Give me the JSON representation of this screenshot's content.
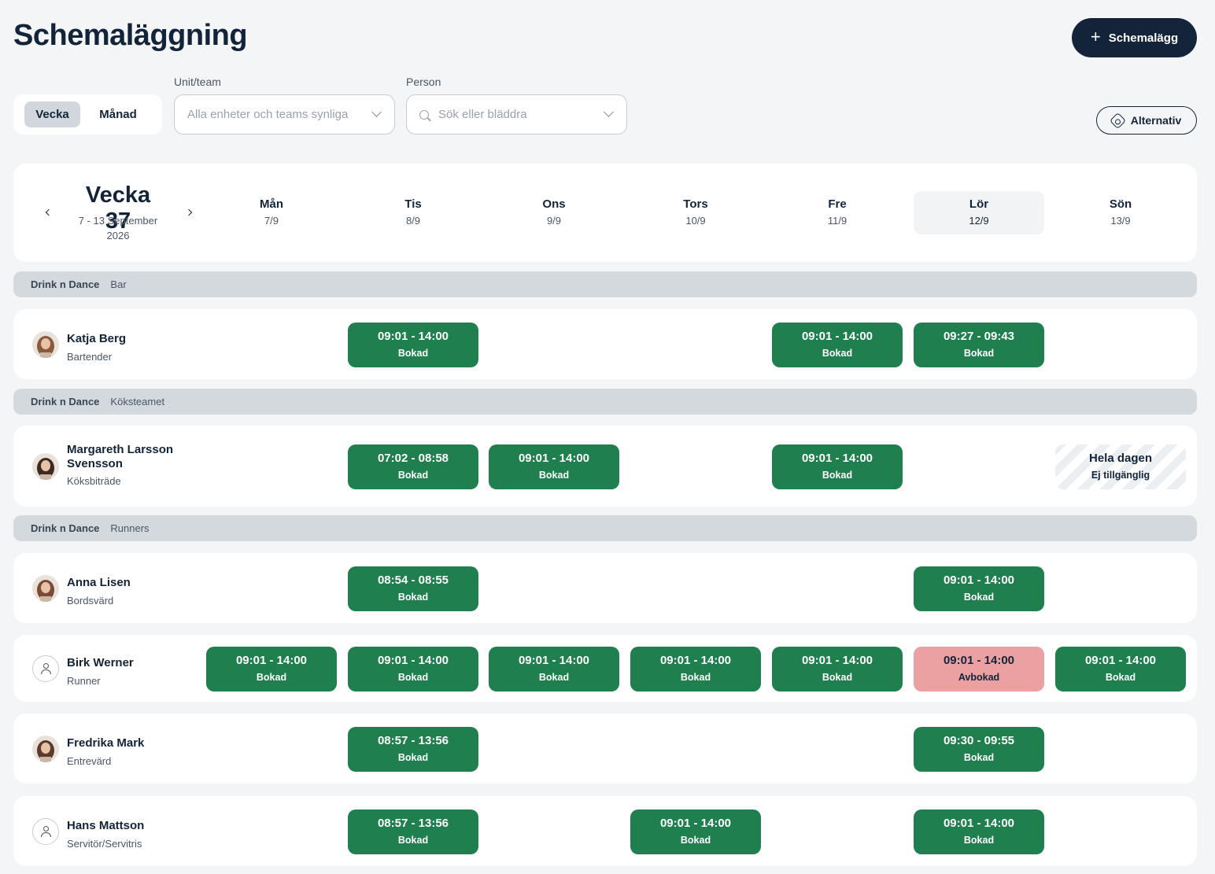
{
  "page": {
    "title": "Schemaläggning",
    "schedule_button": "Schemalägg",
    "schedule_button_icon": "plus-icon"
  },
  "view_toggle": {
    "week": "Vecka",
    "month": "Månad"
  },
  "filters": {
    "unit_label": "Unit/team",
    "unit_placeholder": "Alla enheter och teams synliga",
    "person_label": "Person",
    "person_placeholder": "Sök eller bläddra"
  },
  "options_button": "Alternativ",
  "week": {
    "title": "Vecka 37",
    "range": "7 - 13 September",
    "year": "2026",
    "days": [
      {
        "name": "Mån",
        "date": "7/9"
      },
      {
        "name": "Tis",
        "date": "8/9"
      },
      {
        "name": "Ons",
        "date": "9/9"
      },
      {
        "name": "Tors",
        "date": "10/9"
      },
      {
        "name": "Fre",
        "date": "11/9"
      },
      {
        "name": "Lör",
        "date": "12/9",
        "selected": true
      },
      {
        "name": "Sön",
        "date": "13/9"
      }
    ]
  },
  "groups": [
    {
      "unit": "Drink n Dance",
      "team": "Bar"
    },
    {
      "unit": "Drink n Dance",
      "team": "Köksteamet"
    },
    {
      "unit": "Drink n Dance",
      "team": "Runners"
    }
  ],
  "people": [
    {
      "name": "Katja Berg",
      "role": "Bartender",
      "avatar": "photo",
      "shifts": [
        {
          "day": 1,
          "time": "09:01 - 14:00",
          "status": "Bokad",
          "type": "booked"
        },
        {
          "day": 4,
          "time": "09:01 - 14:00",
          "status": "Bokad",
          "type": "booked"
        },
        {
          "day": 5,
          "time": "09:27 - 09:43",
          "status": "Bokad",
          "type": "booked"
        }
      ]
    },
    {
      "name": "Margareth Larsson Svensson",
      "role": "Köksbiträde",
      "avatar": "photo",
      "shifts": [
        {
          "day": 1,
          "time": "07:02 - 08:58",
          "status": "Bokad",
          "type": "booked"
        },
        {
          "day": 2,
          "time": "09:01 - 14:00",
          "status": "Bokad",
          "type": "booked"
        },
        {
          "day": 4,
          "time": "09:01 - 14:00",
          "status": "Bokad",
          "type": "booked"
        },
        {
          "day": 6,
          "time": "Hela dagen",
          "status": "Ej tillgänglig",
          "type": "unavailable"
        }
      ]
    },
    {
      "name": "Anna Lisen",
      "role": "Bordsvärd",
      "avatar": "photo",
      "shifts": [
        {
          "day": 1,
          "time": "08:54 - 08:55",
          "status": "Bokad",
          "type": "booked"
        },
        {
          "day": 5,
          "time": "09:01 - 14:00",
          "status": "Bokad",
          "type": "booked"
        }
      ]
    },
    {
      "name": "Birk Werner",
      "role": "Runner",
      "avatar": "placeholder",
      "shifts": [
        {
          "day": 0,
          "time": "09:01 - 14:00",
          "status": "Bokad",
          "type": "booked"
        },
        {
          "day": 1,
          "time": "09:01 - 14:00",
          "status": "Bokad",
          "type": "booked"
        },
        {
          "day": 2,
          "time": "09:01 - 14:00",
          "status": "Bokad",
          "type": "booked"
        },
        {
          "day": 3,
          "time": "09:01 - 14:00",
          "status": "Bokad",
          "type": "booked"
        },
        {
          "day": 4,
          "time": "09:01 - 14:00",
          "status": "Bokad",
          "type": "booked"
        },
        {
          "day": 5,
          "time": "09:01 - 14:00",
          "status": "Avbokad",
          "type": "cancelled"
        },
        {
          "day": 6,
          "time": "09:01 - 14:00",
          "status": "Bokad",
          "type": "booked"
        }
      ]
    },
    {
      "name": "Fredrika Mark",
      "role": "Entrevärd",
      "avatar": "photo",
      "shifts": [
        {
          "day": 1,
          "time": "08:57 - 13:56",
          "status": "Bokad",
          "type": "booked"
        },
        {
          "day": 5,
          "time": "09:30 - 09:55",
          "status": "Bokad",
          "type": "booked"
        }
      ]
    },
    {
      "name": "Hans Mattson",
      "role": "Servitör/Servitris",
      "avatar": "placeholder",
      "shifts": [
        {
          "day": 1,
          "time": "08:57 - 13:56",
          "status": "Bokad",
          "type": "booked"
        },
        {
          "day": 3,
          "time": "09:01 - 14:00",
          "status": "Bokad",
          "type": "booked"
        },
        {
          "day": 5,
          "time": "09:01 - 14:00",
          "status": "Bokad",
          "type": "booked"
        }
      ]
    }
  ],
  "colors": {
    "primary": "#13243a",
    "booked": "#1f7f4e",
    "cancelled": "#eba0a2",
    "group_bar": "#d4d9de"
  }
}
